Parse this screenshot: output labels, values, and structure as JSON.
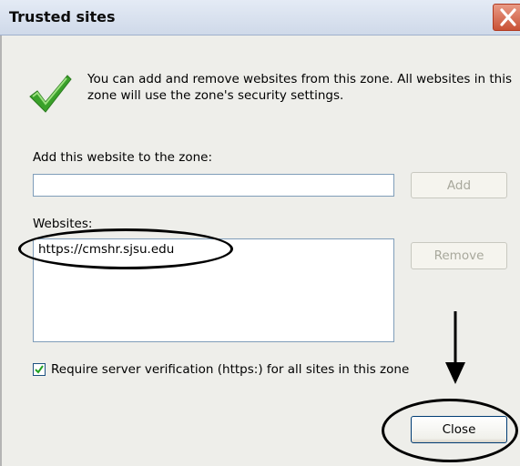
{
  "dialog": {
    "title": "Trusted sites",
    "intro": "You can add and remove websites from this zone. All websites in this zone will use the zone's security settings.",
    "add_label": "Add this website to the zone:",
    "add_input_value": "",
    "add_button": "Add",
    "websites_label": "Websites:",
    "websites": [
      "https://cmshr.sjsu.edu"
    ],
    "remove_button": "Remove",
    "require_https_label": "Require server verification (https:) for all sites in this zone",
    "require_https_checked": true,
    "close_button": "Close"
  },
  "colors": {
    "title_bar": "#cfd9e9",
    "close_x": "#c95236",
    "check_green": "#3aa12a",
    "dialog_bg": "#eeeeea"
  },
  "icons": [
    "checkmark-icon",
    "close-x-icon",
    "checkbox-checked-icon",
    "arrow-down-icon"
  ]
}
